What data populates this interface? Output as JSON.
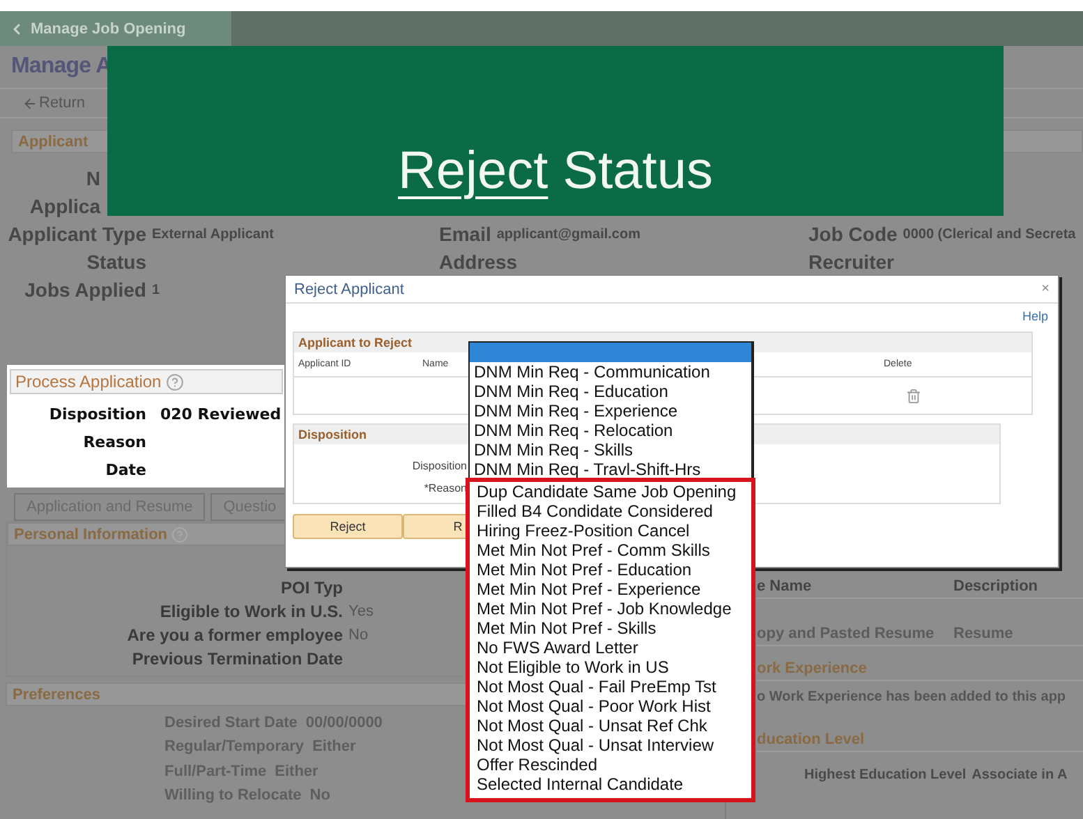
{
  "nav": {
    "back_label": "Manage Job Opening"
  },
  "page_title": "Manage A",
  "toolbar": {
    "return_label": "Return"
  },
  "applicant_section": {
    "title": "Applicant",
    "rows": [
      {
        "fields": [
          {
            "label": "N"
          }
        ]
      },
      {
        "fields": [
          {
            "label": "Applica"
          }
        ]
      },
      {
        "fields": [
          {
            "label": "Applicant Type",
            "value": "External Applicant"
          },
          {
            "label": "Email",
            "value": "applicant@gmail.com"
          },
          {
            "label": "Job Code",
            "value": "0000 (Clerical and Secreta"
          }
        ]
      },
      {
        "fields": [
          {
            "label": "Status"
          },
          {
            "label": "Address"
          },
          {
            "label": "Recruiter"
          }
        ]
      },
      {
        "fields": [
          {
            "label": "Jobs Applied",
            "value": "1"
          }
        ]
      }
    ]
  },
  "banner": {
    "words": [
      {
        "text": "Reject",
        "underlined": true
      },
      {
        "text": "Status",
        "underlined": false
      }
    ]
  },
  "process_application": {
    "title": "Process Application",
    "fields": [
      {
        "label": "Disposition",
        "value": "020 Reviewed"
      },
      {
        "label": "Reason"
      },
      {
        "label": "Date"
      }
    ]
  },
  "tabs": [
    {
      "label": "Application and Resume",
      "selected": false
    },
    {
      "label": "Questio",
      "selected": false
    }
  ],
  "personal_information": {
    "title": "Personal Information",
    "fields": [
      {
        "label": "POI Typ"
      },
      {
        "label": "Eligible to Work in U.S.",
        "value": "Yes"
      },
      {
        "label": "Are you a former employee",
        "value": "No"
      },
      {
        "label": "Previous Termination Date"
      }
    ]
  },
  "preferences": {
    "title": "Preferences",
    "fields": [
      {
        "label": "Desired Start Date",
        "value": "00/00/0000"
      },
      {
        "label": "Regular/Temporary",
        "value": "Either"
      },
      {
        "label": "Full/Part-Time",
        "value": "Either"
      },
      {
        "label": "Willing to Relocate",
        "value": "No"
      }
    ]
  },
  "attachments": {
    "columns": [
      "e Name",
      "Description"
    ],
    "rows": [
      [
        "opy and Pasted Resume",
        "Resume"
      ]
    ]
  },
  "work_experience": {
    "title": "ork Experience",
    "message": "o Work Experience has been added to this app"
  },
  "education": {
    "title": "ducation Level",
    "field": {
      "label": "Highest Education Level",
      "value": "Associate in A"
    }
  },
  "dialog": {
    "title": "Reject Applicant",
    "close": "×",
    "help": "Help",
    "applicants": {
      "title": "Applicant to Reject",
      "columns": [
        "Applicant ID",
        "Name",
        "Delete"
      ]
    },
    "disposition": {
      "title": "Disposition",
      "fields": [
        {
          "label": "Disposition"
        },
        {
          "label": "*Reason"
        }
      ]
    },
    "buttons": [
      "Reject",
      "R"
    ]
  },
  "dropdown": {
    "blank_option": {
      "selected": true
    },
    "options": [
      {
        "label": "DNM Min Req - Communication",
        "selected": false,
        "highlighted": false
      },
      {
        "label": "DNM Min Req - Education",
        "selected": false,
        "highlighted": false
      },
      {
        "label": "DNM Min Req - Experience",
        "selected": false,
        "highlighted": false
      },
      {
        "label": "DNM Min Req - Relocation",
        "selected": false,
        "highlighted": false
      },
      {
        "label": "DNM Min Req - Skills",
        "selected": false,
        "highlighted": false
      },
      {
        "label": "DNM Min Req - Travl-Shift-Hrs",
        "selected": false,
        "highlighted": false
      },
      {
        "label": "Dup Candidate Same Job Opening",
        "selected": false,
        "highlighted": true
      },
      {
        "label": "Filled B4 Condidate Considered",
        "selected": false,
        "highlighted": true
      },
      {
        "label": "Hiring Freez-Position Cancel",
        "selected": false,
        "highlighted": true
      },
      {
        "label": "Met Min Not Pref - Comm Skills",
        "selected": false,
        "highlighted": true
      },
      {
        "label": "Met Min Not Pref - Education",
        "selected": false,
        "highlighted": true
      },
      {
        "label": "Met Min Not Pref - Experience",
        "selected": false,
        "highlighted": true
      },
      {
        "label": "Met Min Not Pref - Job Knowledge",
        "selected": false,
        "highlighted": true
      },
      {
        "label": "Met Min Not Pref  - Skills",
        "selected": false,
        "highlighted": true
      },
      {
        "label": "No FWS Award Letter",
        "selected": false,
        "highlighted": true
      },
      {
        "label": "Not Eligible to Work in US",
        "selected": false,
        "highlighted": true
      },
      {
        "label": "Not Most Qual - Fail PreEmp Tst",
        "selected": false,
        "highlighted": true
      },
      {
        "label": "Not Most Qual - Poor Work Hist",
        "selected": false,
        "highlighted": true
      },
      {
        "label": "Not Most Qual - Unsat Ref Chk",
        "selected": false,
        "highlighted": true
      },
      {
        "label": "Not Most Qual - Unsat Interview",
        "selected": false,
        "highlighted": true
      },
      {
        "label": "Offer Rescinded",
        "selected": false,
        "highlighted": true
      },
      {
        "label": "Selected Internal Candidate",
        "selected": false,
        "highlighted": true
      }
    ]
  }
}
